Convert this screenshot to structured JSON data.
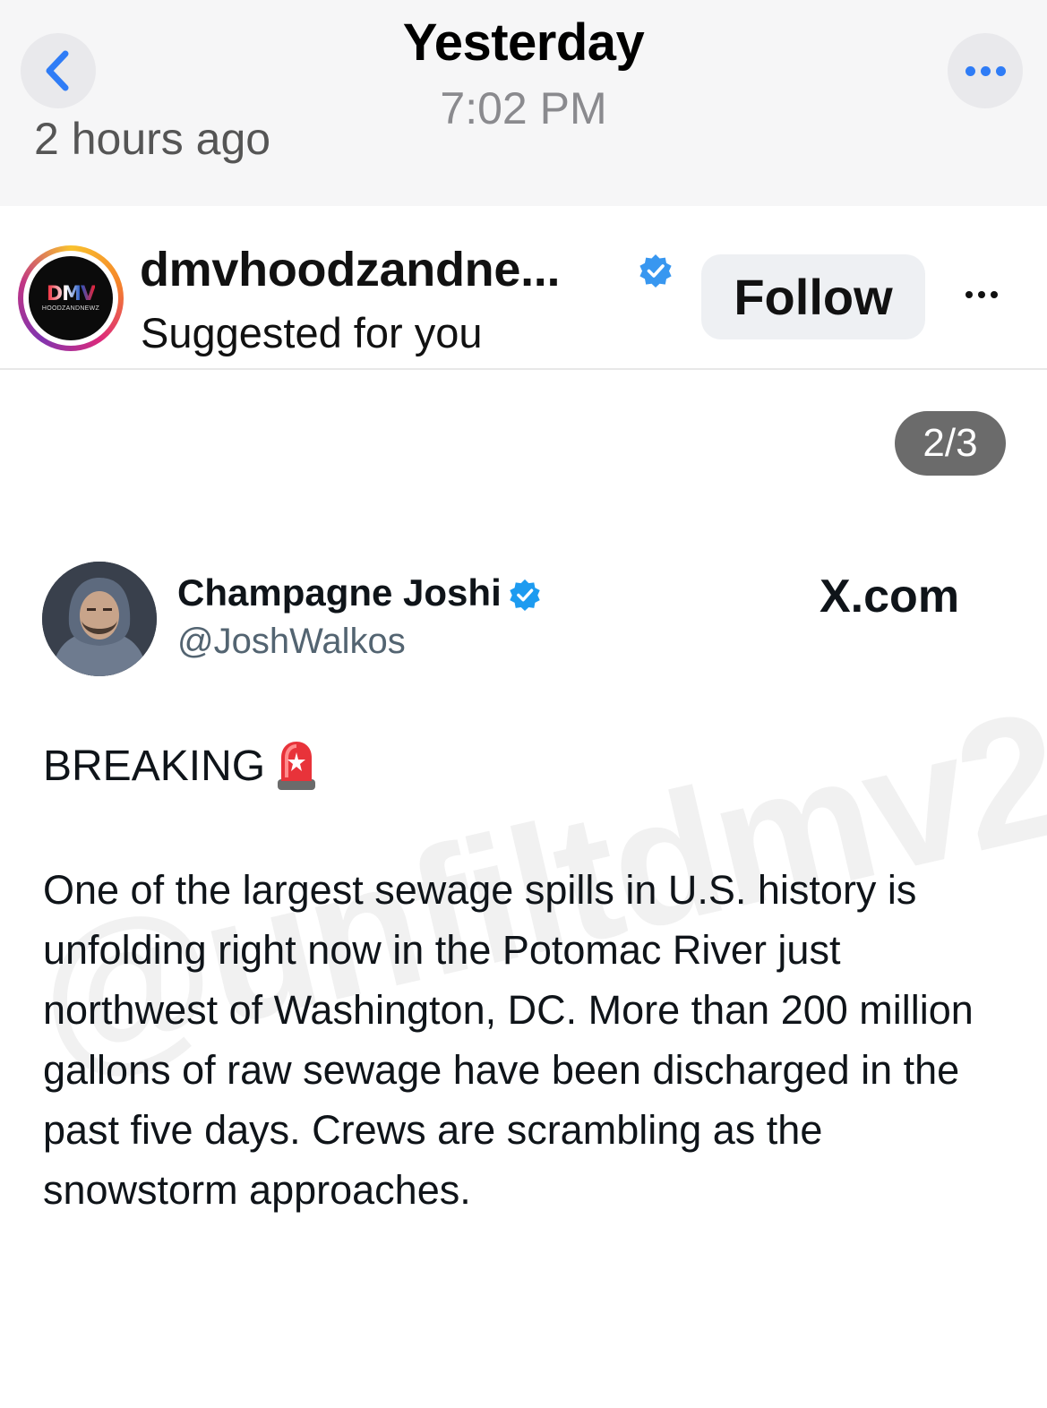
{
  "viewer_header": {
    "title": "Yesterday",
    "time": "7:02 PM",
    "back_icon": "chevron-left-icon",
    "more_icon": "ellipsis-icon",
    "accent": "#2f7cf6"
  },
  "post_meta": {
    "ago_text": "2 hours ago"
  },
  "post_header": {
    "username": "dmvhoodzandne...",
    "subtitle": "Suggested for you",
    "follow_label": "Follow",
    "avatar_logo_text": "DMV",
    "avatar_logo_subtext": "HOODZANDNEWZ",
    "verified": true
  },
  "carousel": {
    "counter": "2/3"
  },
  "tweet": {
    "display_name": "Champagne Joshi",
    "handle": "@JoshWalkos",
    "source": "X.com",
    "headline": "BREAKING",
    "body": "One of the largest sewage spills in U.S. history is unfolding right now in the Potomac River just northwest of Washington, DC. More than 200 million gallons of raw sewage have been discharged in the past five days. Crews are scrambling as the snowstorm approaches.",
    "watermark": "@unfiltdmv2",
    "verified_color": "#1d9bf0"
  }
}
